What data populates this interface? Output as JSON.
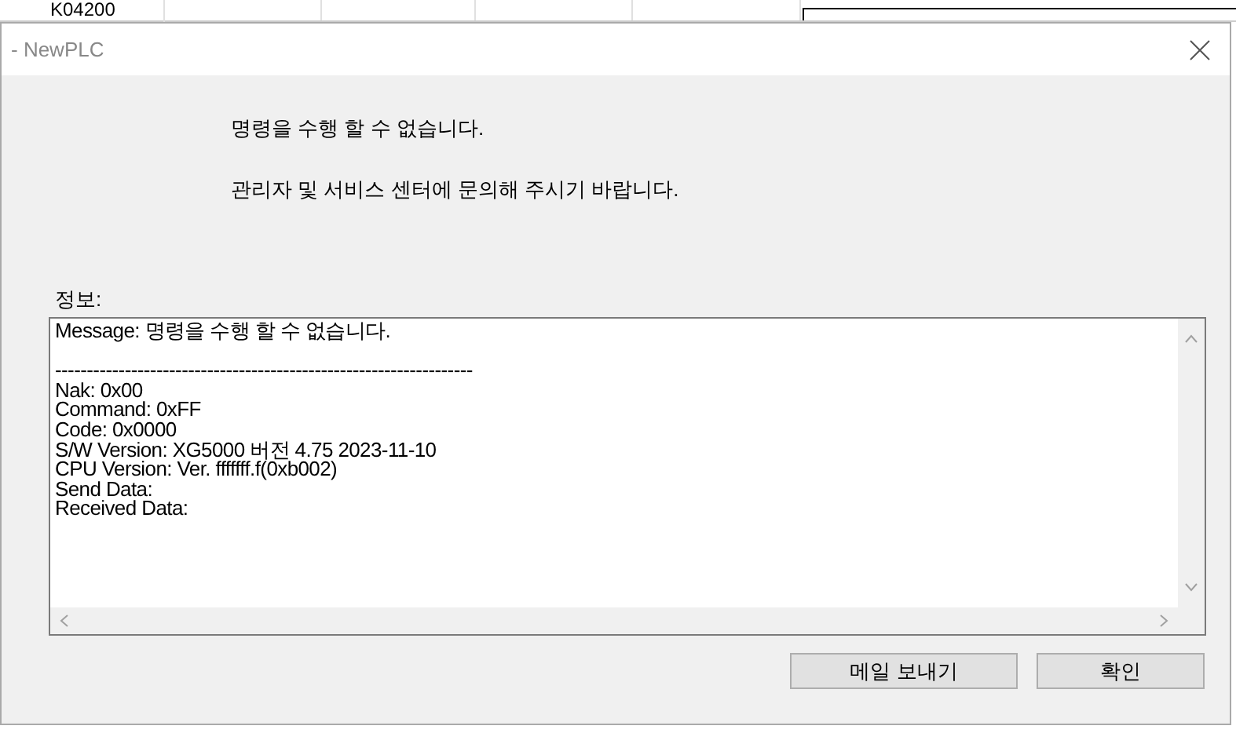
{
  "background": {
    "cell": "K04200"
  },
  "dialog": {
    "title": "- NewPLC",
    "messages": [
      "명령을 수행 할 수 없습니다.",
      "관리자 및 서비스 센터에 문의해 주시기 바랍니다."
    ],
    "info_label": "정보:",
    "info_message": "Message: 명령을 수행 할 수 없습니다.",
    "info_lines": [
      "------------------------------------------------------------------",
      "Nak: 0x00",
      "Command: 0xFF",
      "Code: 0x0000",
      "S/W Version: XG5000 버전 4.75 2023-11-10",
      "CPU Version: Ver. fffffff.f(0xb002)",
      "Send Data:",
      "Received Data:"
    ],
    "buttons": [
      "메일 보내기",
      "확인"
    ]
  }
}
